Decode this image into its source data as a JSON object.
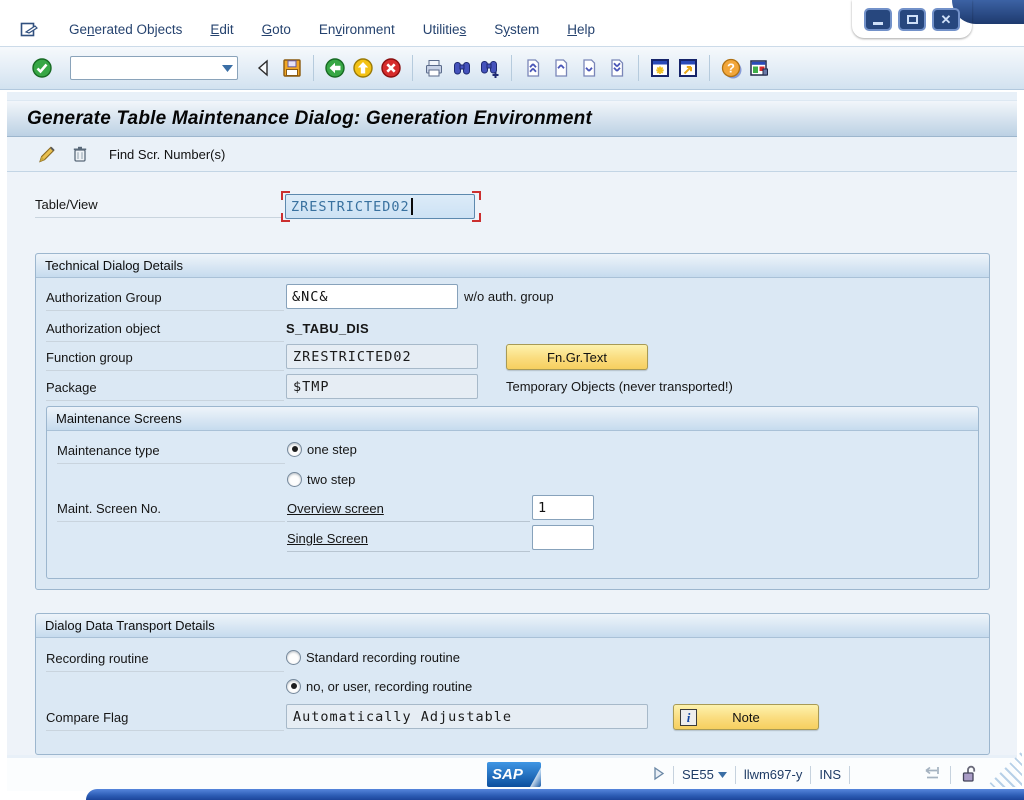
{
  "window": {
    "controls": [
      "minimize",
      "maximize",
      "close"
    ]
  },
  "menu_bar": {
    "items": [
      {
        "pre": "Ge",
        "u": "n",
        "post": "erated Objects"
      },
      {
        "pre": "",
        "u": "E",
        "post": "dit"
      },
      {
        "pre": "",
        "u": "G",
        "post": "oto"
      },
      {
        "pre": "En",
        "u": "v",
        "post": "ironment"
      },
      {
        "pre": "Utilitie",
        "u": "s",
        "post": ""
      },
      {
        "pre": "S",
        "u": "y",
        "post": "stem"
      },
      {
        "pre": "",
        "u": "H",
        "post": "elp"
      }
    ]
  },
  "toolbar": {
    "command_value": "",
    "icons": [
      "enter",
      "command-field",
      "hide-command-field",
      "save",
      "back",
      "exit",
      "cancel",
      "print",
      "find",
      "find-next",
      "first-page",
      "previous-page",
      "next-page",
      "last-page",
      "new-session",
      "create-shortcut",
      "help",
      "customize-layout"
    ]
  },
  "title_bar": {
    "title": "Generate Table Maintenance Dialog: Generation Environment"
  },
  "app_toolbar": {
    "icons": [
      "edit-pencil",
      "delete-trash"
    ],
    "find_button": "Find Scr. Number(s)"
  },
  "form": {
    "table_view": {
      "label": "Table/View",
      "value": "ZRESTRICTED02"
    },
    "technical": {
      "title": "Technical Dialog Details",
      "auth_group_label": "Authorization Group",
      "auth_group_value": "&NC&",
      "auth_group_suffix": "w/o auth. group",
      "auth_object_label": "Authorization object",
      "auth_object_value": "S_TABU_DIS",
      "function_group_label": "Function group",
      "function_group_value": "ZRESTRICTED02",
      "fn_gr_text_button": "Fn.Gr.Text",
      "package_label": "Package",
      "package_value": "$TMP",
      "package_suffix": "Temporary Objects (never transported!)"
    },
    "maintenance_screens": {
      "title": "Maintenance Screens",
      "maintenance_type_label": "Maintenance type",
      "options": [
        {
          "label": "one step",
          "selected": true
        },
        {
          "label": "two step",
          "selected": false
        }
      ],
      "screen_no_label": "Maint. Screen No.",
      "overview_label": "Overview screen",
      "overview_value": "1",
      "single_label": "Single Screen",
      "single_value": ""
    },
    "transport": {
      "title": "Dialog Data Transport Details",
      "recording_label": "Recording routine",
      "options": [
        {
          "label": "Standard recording routine",
          "selected": false
        },
        {
          "label": "no, or user, recording routine",
          "selected": true
        }
      ],
      "compare_flag_label": "Compare Flag",
      "compare_flag_value": "Automatically Adjustable",
      "note_button": "Note"
    }
  },
  "status_bar": {
    "logo_text": "SAP",
    "transaction": "SE55",
    "system": "llwm697-y",
    "mode": "INS"
  },
  "colors": {
    "button_yellow": "#fadc7e",
    "focus_marker": "#cb2f2f",
    "sap_blue": "#0c4f9e",
    "chrome_navy": "#203d72",
    "group_border": "#9cb6ce"
  }
}
